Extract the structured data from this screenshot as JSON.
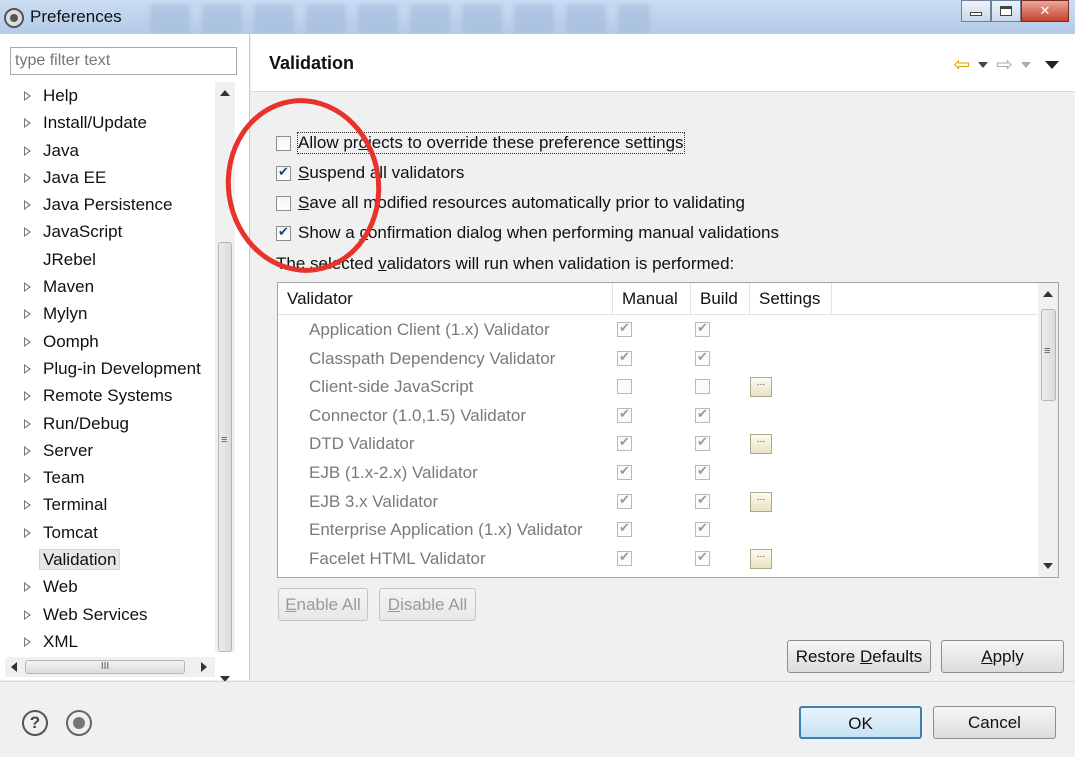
{
  "window": {
    "title": "Preferences"
  },
  "sidebar": {
    "filter_placeholder": "type filter text",
    "items": [
      {
        "label": "Help",
        "expandable": true
      },
      {
        "label": "Install/Update",
        "expandable": true
      },
      {
        "label": "Java",
        "expandable": true
      },
      {
        "label": "Java EE",
        "expandable": true
      },
      {
        "label": "Java Persistence",
        "expandable": true
      },
      {
        "label": "JavaScript",
        "expandable": true
      },
      {
        "label": "JRebel",
        "expandable": false
      },
      {
        "label": "Maven",
        "expandable": true
      },
      {
        "label": "Mylyn",
        "expandable": true
      },
      {
        "label": "Oomph",
        "expandable": true
      },
      {
        "label": "Plug-in Development",
        "expandable": true
      },
      {
        "label": "Remote Systems",
        "expandable": true
      },
      {
        "label": "Run/Debug",
        "expandable": true
      },
      {
        "label": "Server",
        "expandable": true
      },
      {
        "label": "Team",
        "expandable": true
      },
      {
        "label": "Terminal",
        "expandable": true
      },
      {
        "label": "Tomcat",
        "expandable": true
      },
      {
        "label": "Validation",
        "expandable": false,
        "selected": true
      },
      {
        "label": "Web",
        "expandable": true
      },
      {
        "label": "Web Services",
        "expandable": true
      },
      {
        "label": "XML",
        "expandable": true
      }
    ],
    "hscroll_grip": "III"
  },
  "page": {
    "title": "Validation",
    "options": {
      "allow_override": {
        "pre": "Allow pr",
        "mid": "o",
        "post": "jects to override these preference settings",
        "checked": false
      },
      "suspend_all": {
        "pre": "",
        "mid": "S",
        "post": "uspend all validators",
        "checked": true
      },
      "save_all": {
        "pre": "",
        "mid": "S",
        "post": "ave all modified resources automatically prior to validating",
        "checked": false
      },
      "show_confirm": {
        "pre": "Show a ",
        "mid": "c",
        "post": "onfirmation dialog when performing manual validations",
        "checked": true
      }
    },
    "info_pre": "The selected ",
    "info_mid": "v",
    "info_post": "alidators will run when validation is performed:",
    "table": {
      "columns": [
        "Validator",
        "Manual",
        "Build",
        "Settings"
      ],
      "rows": [
        {
          "name": "Application Client (1.x) Validator",
          "manual": true,
          "build": true,
          "settings": false
        },
        {
          "name": "Classpath Dependency Validator",
          "manual": true,
          "build": true,
          "settings": false
        },
        {
          "name": "Client-side JavaScript",
          "manual": false,
          "build": false,
          "settings": true
        },
        {
          "name": "Connector (1.0,1.5) Validator",
          "manual": true,
          "build": true,
          "settings": false
        },
        {
          "name": "DTD Validator",
          "manual": true,
          "build": true,
          "settings": true
        },
        {
          "name": "EJB (1.x-2.x) Validator",
          "manual": true,
          "build": true,
          "settings": false
        },
        {
          "name": "EJB 3.x Validator",
          "manual": true,
          "build": true,
          "settings": true
        },
        {
          "name": "Enterprise Application (1.x) Validator",
          "manual": true,
          "build": true,
          "settings": false
        },
        {
          "name": "Facelet HTML Validator",
          "manual": true,
          "build": true,
          "settings": true
        }
      ],
      "settings_glyph": "..."
    },
    "enable_all": {
      "pre": "",
      "mid": "E",
      "post": "nable All"
    },
    "disable_all": {
      "pre": "",
      "mid": "D",
      "post": "isable All"
    },
    "restore_defaults": {
      "pre": "Restore ",
      "mid": "D",
      "post": "efaults"
    },
    "apply": {
      "pre": "",
      "mid": "A",
      "post": "pply"
    }
  },
  "footer": {
    "ok_label": "OK",
    "cancel_label": "Cancel",
    "help_glyph": "?"
  },
  "colors": {
    "annotation": "#e8322c",
    "default_button": "#3c7fb1"
  }
}
